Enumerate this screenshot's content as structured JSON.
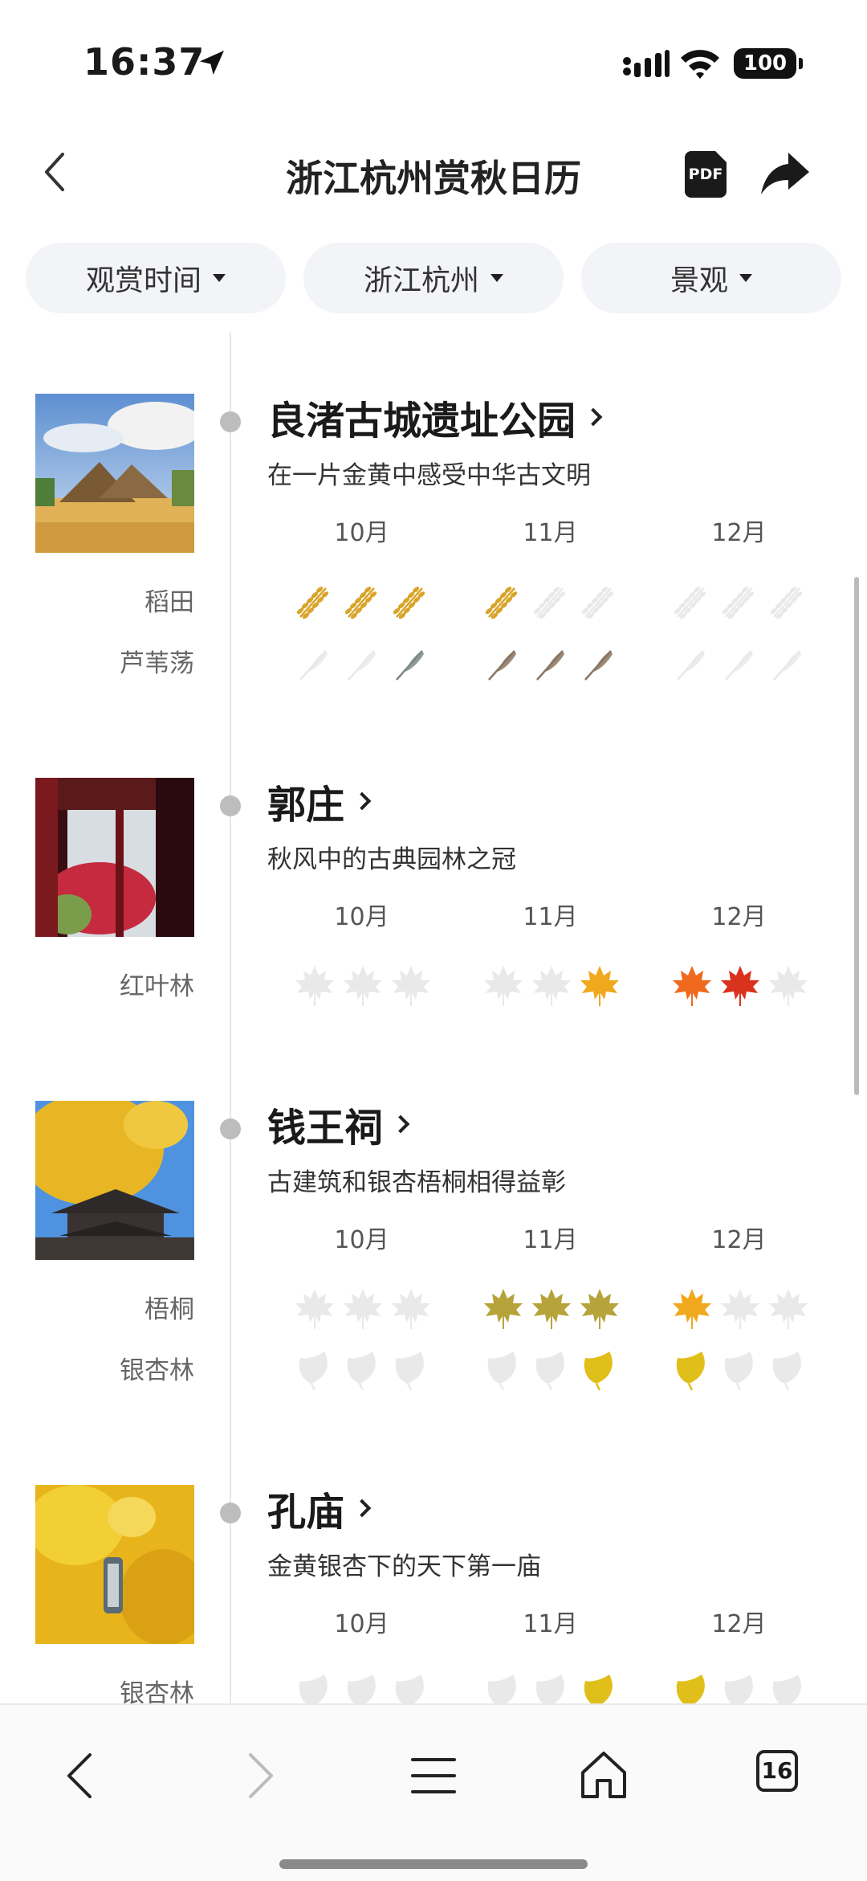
{
  "status": {
    "time": "16:37",
    "battery": "100"
  },
  "nav": {
    "title": "浙江杭州赏秋日历",
    "pdf_label": "PDF"
  },
  "filters": [
    {
      "label": "观赏时间"
    },
    {
      "label": "浙江杭州"
    },
    {
      "label": "景观"
    }
  ],
  "months": [
    "10月",
    "11月",
    "12月"
  ],
  "colors": {
    "accent": "#222222",
    "chip_bg": "#f3f4f7",
    "dot": "#bdbdbd",
    "rice": "#d9a42a",
    "reed": "#8a7660",
    "maple_yellow": "#f0a81c",
    "maple_red": "#d9331e",
    "ginkgo": "#e1bf1a",
    "inactive": "#e9e9e9"
  },
  "places": [
    {
      "name": "良渚古城遗址公园",
      "desc": "在一片金黄中感受中华古文明",
      "rows": [
        {
          "label": "稻田",
          "icon": "rice-icon",
          "states": [
            1,
            1,
            1,
            1,
            0,
            0,
            0,
            0,
            0
          ]
        },
        {
          "label": "芦苇荡",
          "icon": "reed-icon",
          "states": [
            0,
            0,
            2,
            1,
            1,
            1,
            0,
            0,
            0
          ]
        }
      ]
    },
    {
      "name": "郭庄",
      "desc": "秋风中的古典园林之冠",
      "rows": [
        {
          "label": "红叶林",
          "icon": "maple-icon",
          "states": [
            0,
            0,
            0,
            0,
            0,
            1,
            2,
            3,
            0
          ]
        }
      ]
    },
    {
      "name": "钱王祠",
      "desc": "古建筑和银杏梧桐相得益彰",
      "rows": [
        {
          "label": "梧桐",
          "icon": "sycamore-icon",
          "states": [
            0,
            0,
            0,
            1,
            1,
            1,
            2,
            0,
            0
          ]
        },
        {
          "label": "银杏林",
          "icon": "ginkgo-icon",
          "states": [
            0,
            0,
            0,
            0,
            0,
            1,
            1,
            0,
            0
          ]
        }
      ]
    },
    {
      "name": "孔庙",
      "desc": "金黄银杏下的天下第一庙",
      "rows": [
        {
          "label": "银杏林",
          "icon": "ginkgo-icon",
          "states": [
            0,
            0,
            0,
            0,
            0,
            1,
            1,
            0,
            0
          ]
        }
      ]
    }
  ],
  "bottom": {
    "tab_count": "16"
  }
}
